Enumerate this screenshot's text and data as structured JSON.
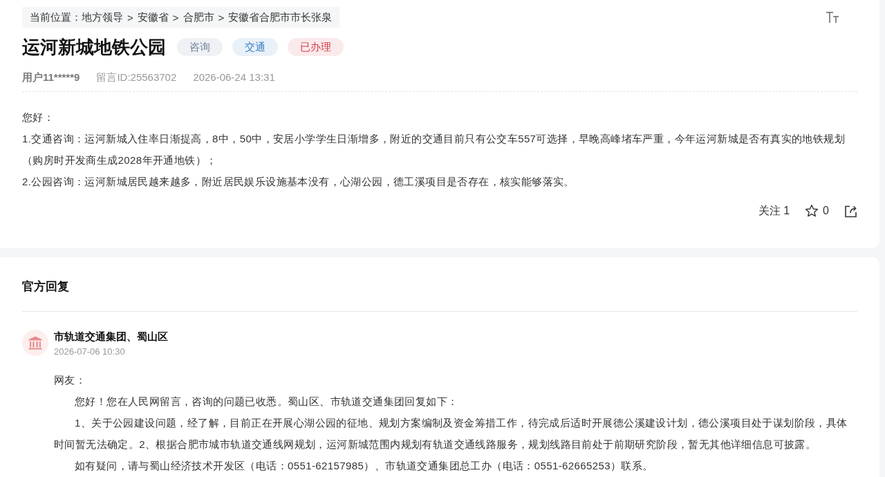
{
  "breadcrumb": {
    "label": "当前位置：",
    "items": [
      "地方领导",
      "安徽省",
      "合肥市",
      "安徽省合肥市市长张泉"
    ],
    "separators": [
      ">",
      ">",
      ">"
    ]
  },
  "message": {
    "title": "运河新城地铁公园",
    "tags": [
      {
        "text": "咨询",
        "color": "#6f819c"
      },
      {
        "text": "交通",
        "color": "#3a7dc2"
      },
      {
        "text": "已办理",
        "color": "#d2404a"
      }
    ],
    "author": "用户11*****9",
    "message_id": "留言ID:25563702",
    "time": "2026-06-24 13:31",
    "body": [
      "您好：",
      "1.交通咨询：运河新城入住率日渐提高，8中，50中，安居小学学生日渐增多，附近的交通目前只有公交车557可选择，早晚高峰堵车严重，今年运河新城是否有真实的地铁规划（购房时开发商生成2028年开通地铁）；",
      "2.公园咨询：运河新城居民越来越多，附近居民娱乐设施基本没有，心湖公园，德工溪项目是否存在，核实能够落实。"
    ],
    "actions": {
      "follow_label": "关注",
      "follow_count": "1",
      "star_count": "0"
    }
  },
  "official_reply": {
    "heading": "官方回复",
    "replies": [
      {
        "org": "市轨道交通集团、蜀山区",
        "time": "2026-07-06 10:30",
        "salutation": "网友：",
        "paragraphs": [
          "您好！您在人民网留言，咨询的问题已收悉。蜀山区、市轨道交通集团回复如下：",
          "1、关于公园建设问题，经了解，目前正在开展心湖公园的征地、规划方案编制及资金筹措工作，待完成后适时开展德公溪建设计划，德公溪项目处于谋划阶段，具体时间暂无法确定。2、根据合肥市城市轨道交通线网规划，运河新城范围内规划有轨道交通线路服务，规划线路目前处于前期研究阶段，暂无其他详细信息可披露。",
          "如有疑问，请与蜀山经济技术开发区（电话：0551-62157985）、市轨道交通集团总工办（电话：0551-62665253）联系。"
        ]
      }
    ]
  }
}
